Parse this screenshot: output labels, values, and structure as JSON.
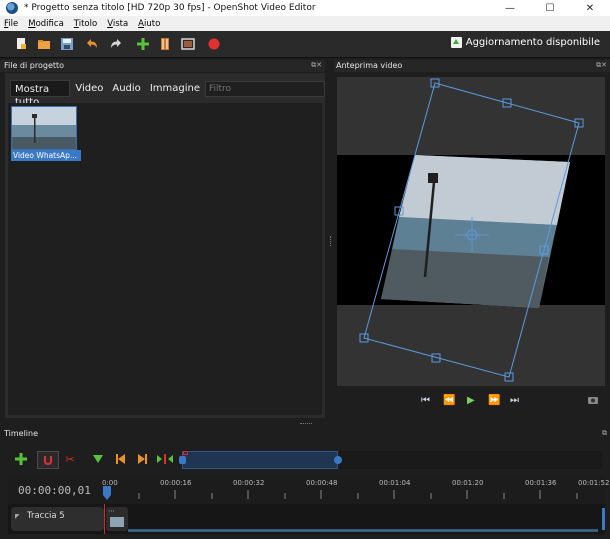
{
  "window": {
    "title": "* Progetto senza titolo [HD 720p 30 fps] - OpenShot Video Editor",
    "minimize_glyph": "—",
    "maximize_glyph": "☐",
    "close_glyph": "✕"
  },
  "menu": [
    "File",
    "Modifica",
    "Titolo",
    "Vista",
    "Aiuto"
  ],
  "toolbar": {
    "update_label": "Aggiornamento disponibile",
    "icons": [
      "new-project-icon",
      "open-project-icon",
      "save-project-icon",
      "undo-icon",
      "redo-icon",
      "import-files-icon",
      "choose-profile-icon",
      "fullscreen-icon",
      "export-video-icon"
    ]
  },
  "files_panel": {
    "title": "File di progetto",
    "tabs": [
      "Mostra tutto",
      "Video",
      "Audio",
      "Immagine"
    ],
    "filter_placeholder": "Filtro",
    "items": [
      {
        "caption": "Video WhatsAp..."
      }
    ]
  },
  "preview_panel": {
    "title": "Anteprima video",
    "transport": [
      "⏮",
      "⏪",
      "▶",
      "⏩",
      "⏭"
    ]
  },
  "timeline": {
    "title": "Timeline",
    "timecode": "00:00:00,01",
    "ticks": [
      "0:00",
      "00:00:16",
      "00:00:32",
      "00:00:48",
      "00:01:04",
      "00:01:20",
      "00:01:36",
      "00:01:52"
    ],
    "tracks": [
      {
        "name": "Traccia 5"
      }
    ]
  },
  "colors": {
    "accent_blue": "#3a78c8",
    "playhead_red": "#d62828",
    "record_red": "#e03030",
    "add_green": "#57c23a"
  }
}
